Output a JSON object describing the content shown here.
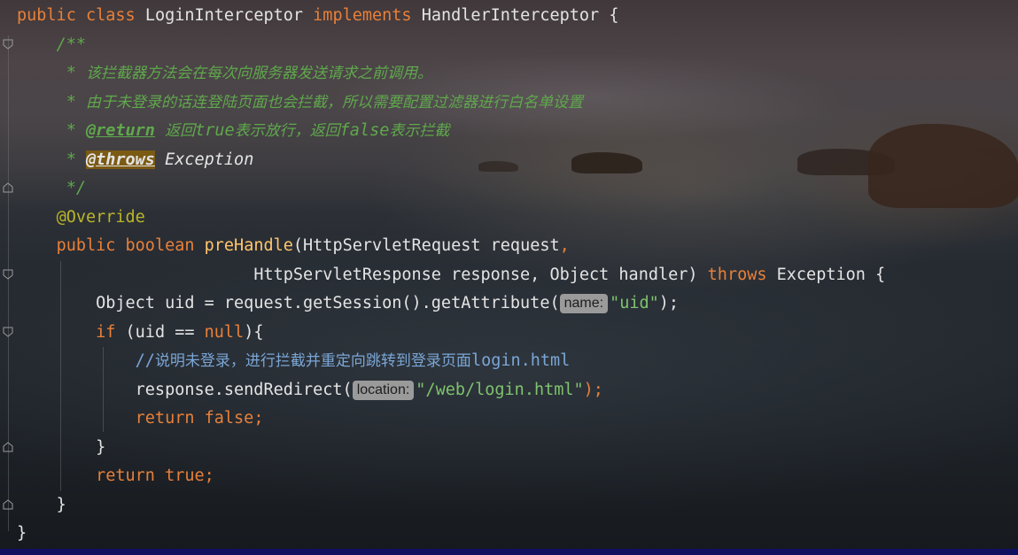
{
  "code": {
    "class_decl": {
      "kw_public": "public",
      "kw_class": "class",
      "class_name": "LoginInterceptor",
      "kw_implements": "implements",
      "interface_name": "HandlerInterceptor",
      "open_brace": "{"
    },
    "javadoc": {
      "open": "/**",
      "star": "*",
      "line1": "该拦截器方法会在每次向服务器发送请求之前调用。",
      "line2": "由于未登录的话连登陆页面也会拦截，所以需要配置过滤器进行白名单设置",
      "return_tag": "@return",
      "return_text_a": "返回",
      "return_true": "true",
      "return_text_b": "表示放行，返回",
      "return_false": "false",
      "return_text_c": "表示拦截",
      "throws_tag": "@throws",
      "throws_type": "Exception",
      "close": "*/"
    },
    "annotation": "@Override",
    "method": {
      "kw_public": "public",
      "kw_boolean": "boolean",
      "name": "preHandle",
      "param1": "(HttpServletRequest request",
      "comma": ",",
      "param2": "HttpServletResponse response, Object handler)",
      "kw_throws": "throws",
      "exception": "Exception {"
    },
    "stmt1": {
      "prefix": "Object uid = request.getSession().getAttribute(",
      "hint": "name:",
      "arg": "\"uid\"",
      "suffix": ");"
    },
    "if_stmt": {
      "kw_if": "if",
      "cond": " (uid == ",
      "kw_null": "null",
      "rest": "){"
    },
    "line_comment": {
      "slashes": "//",
      "text_cn": "说明未登录，进行拦截并重定向跳转到登录页面",
      "text_en": "login.html"
    },
    "redirect": {
      "prefix": "response.sendRedirect(",
      "hint": "location:",
      "arg": "\"/web/login.html\"",
      "suffix": ");"
    },
    "return_false": {
      "kw_return": "return",
      "kw_false": "false",
      "semi": ";"
    },
    "if_close": "}",
    "return_true": {
      "kw_return": "return",
      "kw_true": "true",
      "semi": ";"
    },
    "method_close": "}",
    "class_close": "}"
  },
  "colors": {
    "keyword": "#e8803a",
    "method_name": "#ffc66d",
    "annotation": "#bbb529",
    "string": "#7fc36e",
    "doc_comment": "#5fa84c",
    "line_comment": "#7aa6d6",
    "text": "#e4e4e4",
    "hint_bg": "#9a9a9a"
  },
  "icons": [
    "fold-marker-icon"
  ]
}
